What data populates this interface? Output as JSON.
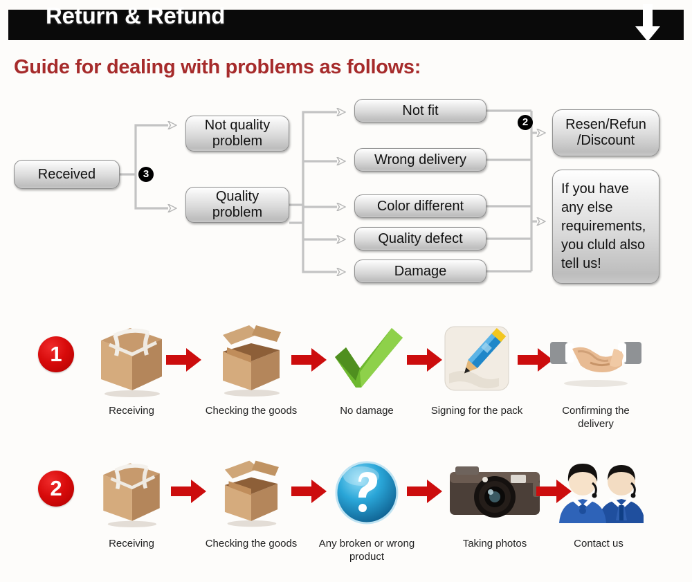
{
  "header": {
    "title": "Return & Refund",
    "arrow_icon": "down-arrow-icon"
  },
  "guide": {
    "title": "Guide for dealing with problems as follows:"
  },
  "flowchart": {
    "badges": [
      {
        "id": "badge-3",
        "label": "3"
      },
      {
        "id": "badge-2",
        "label": "2"
      }
    ],
    "nodes": [
      {
        "id": "received",
        "label": "Received"
      },
      {
        "id": "not-quality",
        "label": "Not quality problem"
      },
      {
        "id": "quality",
        "label": "Quality problem"
      },
      {
        "id": "not-fit",
        "label": "Not fit"
      },
      {
        "id": "wrong-delivery",
        "label": "Wrong delivery"
      },
      {
        "id": "color-different",
        "label": "Color different"
      },
      {
        "id": "quality-defect",
        "label": "Quality defect"
      },
      {
        "id": "damage",
        "label": "Damage"
      },
      {
        "id": "resend-refund",
        "label": "Resen/Refun /Discount"
      },
      {
        "id": "contact-note",
        "label": "If you have any else requirements, you cluld also tell us!"
      }
    ],
    "node_lines": {
      "not_quality": [
        "Not quality",
        "problem"
      ],
      "quality": [
        "Quality",
        "problem"
      ],
      "resend_refund": [
        "Resen/Refun",
        "/Discount"
      ],
      "contact_note": [
        "If you have",
        "any else",
        "requirements,",
        "you cluld also",
        "tell us!"
      ]
    }
  },
  "process_rows": [
    {
      "number": "1",
      "steps": [
        {
          "icon": "sealed-box-icon",
          "label": "Receiving"
        },
        {
          "icon": "open-box-icon",
          "label": "Checking the goods"
        },
        {
          "icon": "green-check-icon",
          "label": "No damage"
        },
        {
          "icon": "pencil-sign-icon",
          "label": "Signing for the pack"
        },
        {
          "icon": "handshake-icon",
          "label": "Confirming the delivery"
        }
      ]
    },
    {
      "number": "2",
      "steps": [
        {
          "icon": "sealed-box-icon",
          "label": "Receiving"
        },
        {
          "icon": "open-box-icon",
          "label": "Checking the goods"
        },
        {
          "icon": "question-mark-icon",
          "label": "Any broken or wrong product"
        },
        {
          "icon": "camera-icon",
          "label": "Taking photos"
        },
        {
          "icon": "support-agents-icon",
          "label": "Contact us"
        }
      ]
    }
  ],
  "colors": {
    "header_bg": "#0a0a0a",
    "guide_red": "#a62b2b",
    "arrow_red": "#cc0d0d",
    "badge_black": "#000000"
  }
}
